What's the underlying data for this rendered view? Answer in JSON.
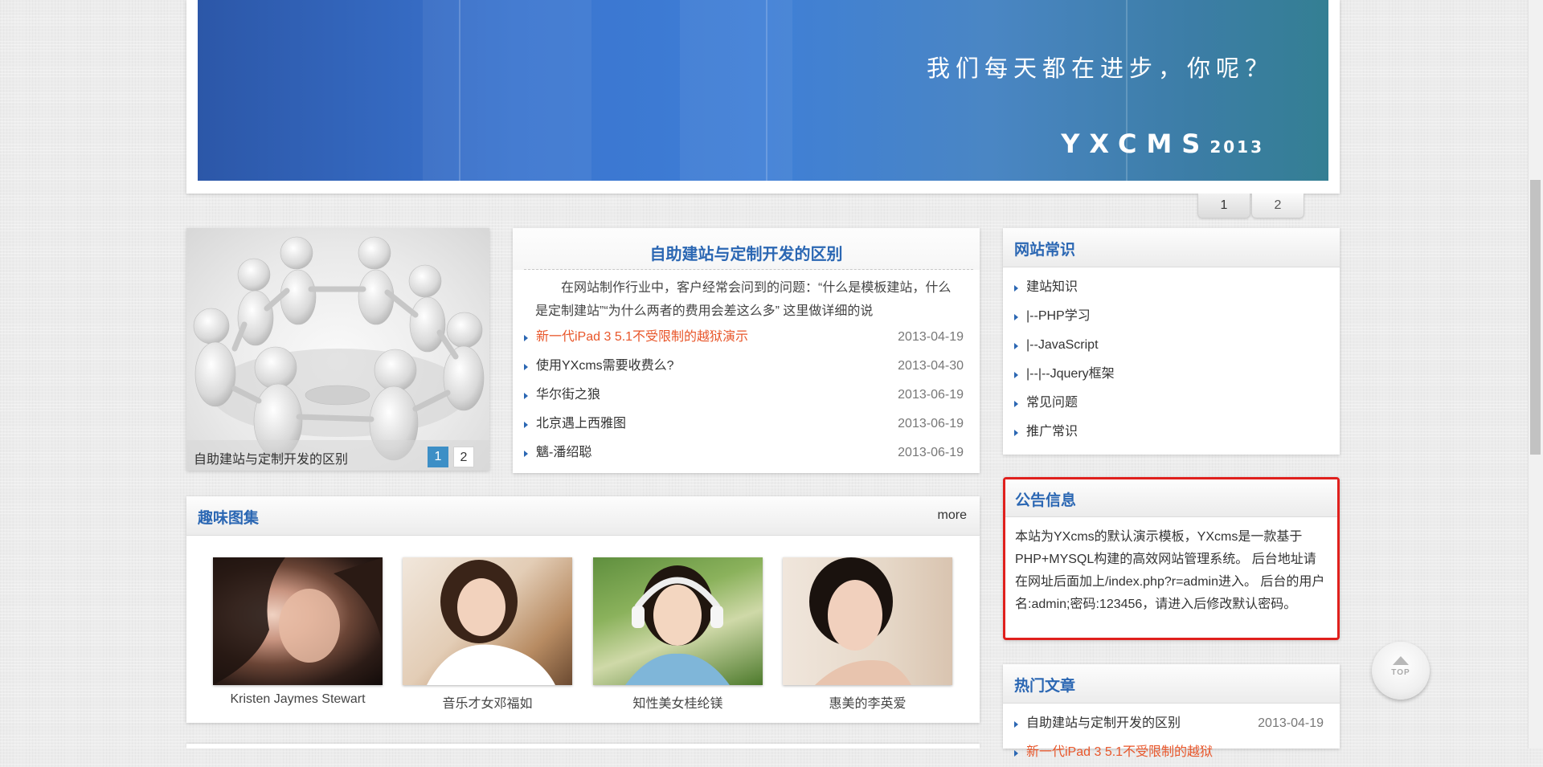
{
  "banner": {
    "slogan": "我们每天都在进步，你呢？",
    "brand": "YXCMS",
    "year": "2013",
    "slides": [
      "1",
      "2"
    ]
  },
  "feature": {
    "caption": "自助建站与定制开发的区别",
    "pages": [
      "1",
      "2"
    ]
  },
  "news": {
    "title": "自助建站与定制开发的区别",
    "intro": "在网站制作行业中，客户经常会问到的问题：“什么是模板建站，什么是定制建站”“为什么两者的费用会差这么多” 这里做详细的说",
    "items": [
      {
        "title": "新一代iPad 3 5.1不受限制的越狱演示",
        "date": "2013-04-19",
        "highlight": true
      },
      {
        "title": "使用YXcms需要收费么?",
        "date": "2013-04-30"
      },
      {
        "title": "华尔街之狼",
        "date": "2013-06-19"
      },
      {
        "title": "北京遇上西雅图",
        "date": "2013-06-19"
      },
      {
        "title": "魑-潘绍聪",
        "date": "2013-06-19"
      }
    ]
  },
  "categories": {
    "title": "网站常识",
    "items": [
      "建站知识",
      "|--PHP学习",
      "|--JavaScript",
      "|--|--Jquery框架",
      "常见问题",
      "推广常识"
    ]
  },
  "notice": {
    "title": "公告信息",
    "body": "本站为YXcms的默认演示模板，YXcms是一款基于PHP+MYSQL构建的高效网站管理系统。 后台地址请在网址后面加上/index.php?r=admin进入。 后台的用户名:admin;密码:123456，请进入后修改默认密码。"
  },
  "hot": {
    "title": "热门文章",
    "items": [
      {
        "title": "自助建站与定制开发的区别",
        "date": "2013-04-19"
      },
      {
        "title": "新一代iPad 3 5.1不受限制的越狱",
        "date": ""
      }
    ]
  },
  "gallery": {
    "title": "趣味图集",
    "more": "more",
    "photos": [
      {
        "caption": "Kristen Jaymes Stewart"
      },
      {
        "caption": "音乐才女邓福如"
      },
      {
        "caption": "知性美女桂纶镁"
      },
      {
        "caption": "惠美的李英爱"
      }
    ]
  },
  "top_button": {
    "label": "TOP"
  },
  "colors": {
    "accent": "#2b67b3",
    "highlight": "#e8562a",
    "notice_border": "#e0201d",
    "active_page": "#3d8fc6"
  }
}
